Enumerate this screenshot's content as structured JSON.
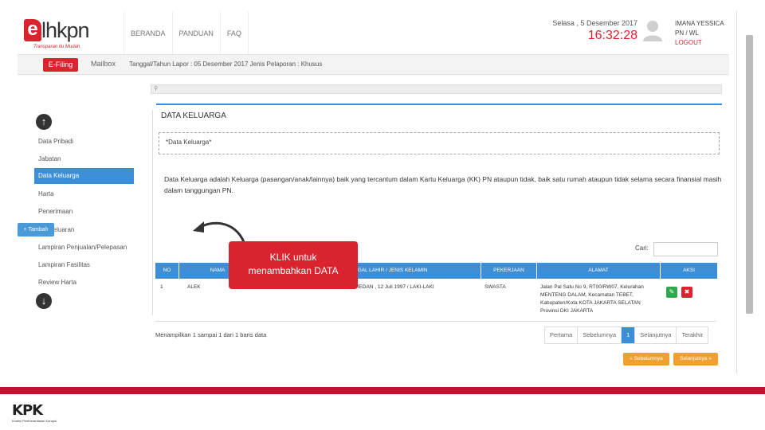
{
  "header": {
    "logo_mark": "e",
    "logo_word": "lhkpn",
    "logo_tagline": "Transparan itu Mudah",
    "nav": [
      "BERANDA",
      "PANDUAN",
      "FAQ"
    ],
    "date": "Selasa , 5 Desember 2017",
    "time": "16:32:28",
    "user_name": "IMANA YESSICA",
    "user_role": "PN / WL",
    "logout": "LOGOUT"
  },
  "subbar": {
    "efiling": "E-Filing",
    "mailbox": "Mailbox",
    "report_info": "Tanggal/Tahun Lapor : 05 Desember 2017   Jenis Pelaporan : Khusus"
  },
  "sidebar": {
    "up_icon": "arrow-up-icon",
    "down_icon": "arrow-down-icon",
    "items": [
      {
        "label": "Data Pribadi",
        "active": false
      },
      {
        "label": "Jabatan",
        "active": false
      },
      {
        "label": "Data Keluarga",
        "active": true
      },
      {
        "label": "Harta",
        "active": false
      },
      {
        "label": "Penerimaan",
        "active": false
      },
      {
        "label": "Pengeluaran",
        "active": false
      },
      {
        "label": "Lampiran Penjualan/Pelepasan",
        "active": false
      },
      {
        "label": "Lampiran Fasilitas",
        "active": false
      },
      {
        "label": "Review Harta",
        "active": false
      }
    ]
  },
  "content": {
    "title": "DATA KELUARGA",
    "note": "*Data Keluarga*",
    "info": "Data Keluarga adalah Keluarga (pasangan/anak/lainnya) baik yang tercantum dalam Kartu Keluarga (KK) PN ataupun tidak, baik satu rumah ataupun tidak selama secara finansial masih dalam tanggungan PN.",
    "add_button": "+ Tambah",
    "search_label": "Cari:",
    "search_value": ""
  },
  "table": {
    "headers": [
      "NO",
      "NAMA",
      "TEMPAT DAN TANGGAL LAHIR / JENIS KELAMIN",
      "PEKERJAAN",
      "ALAMAT",
      "AKSI"
    ],
    "rows": [
      {
        "no": "1",
        "nama": "ALEK",
        "ttl": "MEDAN , 12 Juli 1997 / LAKI-LAKI",
        "pekerjaan": "SWASTA",
        "alamat_1": "Jalan Pal Satu No 9, RT00/RW07, Kelurahan",
        "alamat_2": "MENTENG DALAM, Kecamatan TEBET,",
        "alamat_3": "Kabupaten/Kota KOTA JAKARTA SELATAN",
        "alamat_4": "Provinsi DKI JAKARTA"
      }
    ],
    "edit_icon": "pencil-icon",
    "delete_icon": "trash-icon"
  },
  "footer_table": {
    "showing": "Menampilkan 1 sampai 1 dari 1 baris data",
    "pager": [
      "Pertama",
      "Sebelumnya",
      "1",
      "Selanjutnya",
      "Terakhir"
    ],
    "prev_button": "« Sebelumnya",
    "next_button": "Selanjutnya »"
  },
  "callout": {
    "line1": "KLIK untuk",
    "line2": "menambahkan DATA"
  },
  "footer": {
    "brand": "KPK",
    "brand_sub": "Komisi Pemberantasan Korupsi"
  },
  "colors": {
    "brand_red": "#d9232e",
    "accent_blue": "#3c8fd6",
    "orange": "#f0a030"
  }
}
